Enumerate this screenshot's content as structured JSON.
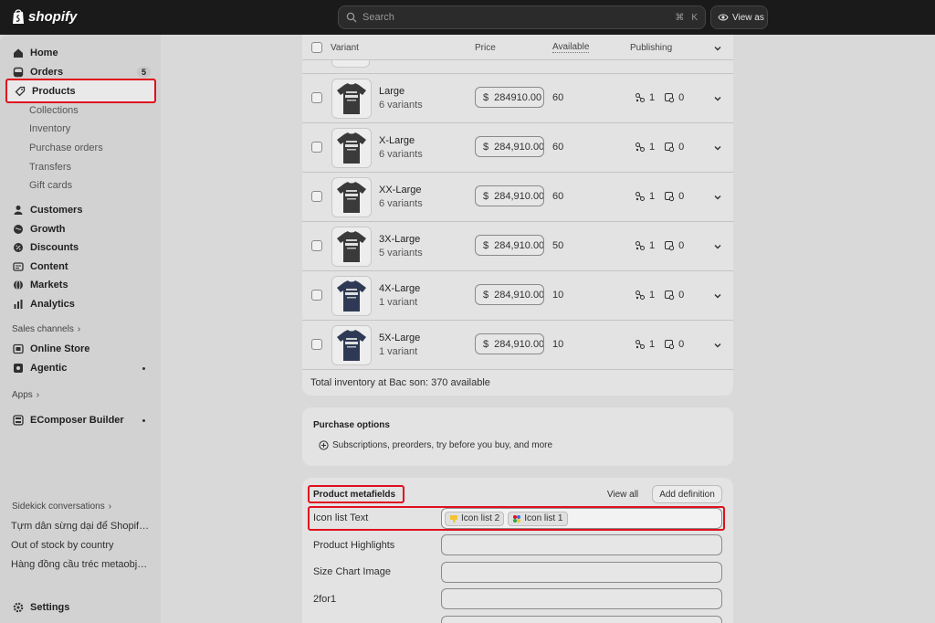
{
  "topbar": {
    "logo": "shopify",
    "search_placeholder": "Search",
    "shortcut_cmd": "⌘",
    "shortcut_key": "K",
    "view_as": "View as"
  },
  "sidebar": {
    "items": [
      {
        "label": "Home",
        "icon": "home-icon"
      },
      {
        "label": "Orders",
        "icon": "orders-icon",
        "badge": "5"
      },
      {
        "label": "Products",
        "icon": "tag-icon"
      },
      {
        "label": "Collections"
      },
      {
        "label": "Inventory"
      },
      {
        "label": "Purchase orders"
      },
      {
        "label": "Transfers"
      },
      {
        "label": "Gift cards"
      },
      {
        "label": "Customers",
        "icon": "person-icon"
      },
      {
        "label": "Growth",
        "icon": "globe-icon"
      },
      {
        "label": "Discounts",
        "icon": "discount-icon"
      },
      {
        "label": "Content",
        "icon": "content-icon"
      },
      {
        "label": "Markets",
        "icon": "globe-icon"
      },
      {
        "label": "Analytics",
        "icon": "chart-icon"
      }
    ],
    "sales_channels_label": "Sales channels",
    "channels": [
      {
        "label": "Online Store",
        "icon": "store-icon"
      },
      {
        "label": "Agentic",
        "icon": "agentic-icon"
      }
    ],
    "apps_label": "Apps",
    "apps": [
      {
        "label": "EComposer Builder",
        "icon": "app-icon"
      }
    ],
    "sidekick_label": "Sidekick conversations",
    "conversations": [
      "Tựm dẫn sừng dại để Shopify ...",
      "Out of stock by country",
      "Hàng đồng cầu tréc metaobjec..."
    ],
    "settings": "Settings"
  },
  "variants_table": {
    "headers": {
      "variant": "Variant",
      "price": "Price",
      "available": "Available",
      "publishing": "Publishing"
    },
    "currency": "$",
    "rows": [
      {
        "name": "Large",
        "count": "6 variants",
        "price": "284910.00",
        "available": "60",
        "pub1": "1",
        "pub2": "0",
        "color": "#3a3a3a"
      },
      {
        "name": "X-Large",
        "count": "6 variants",
        "price": "284,910.00",
        "available": "60",
        "pub1": "1",
        "pub2": "0",
        "color": "#3a3a3a"
      },
      {
        "name": "XX-Large",
        "count": "6 variants",
        "price": "284,910.00",
        "available": "60",
        "pub1": "1",
        "pub2": "0",
        "color": "#3a3a3a"
      },
      {
        "name": "3X-Large",
        "count": "5 variants",
        "price": "284,910.00",
        "available": "50",
        "pub1": "1",
        "pub2": "0",
        "color": "#3a3a3a"
      },
      {
        "name": "4X-Large",
        "count": "1 variant",
        "price": "284,910.00",
        "available": "10",
        "pub1": "1",
        "pub2": "0",
        "color": "#2e3a55"
      },
      {
        "name": "5X-Large",
        "count": "1 variant",
        "price": "284,910.00",
        "available": "10",
        "pub1": "1",
        "pub2": "0",
        "color": "#2e3a55"
      }
    ],
    "total_inventory": "Total inventory at Bac son: 370 available"
  },
  "purchase_options": {
    "title": "Purchase options",
    "link": "Subscriptions, preorders, try before you buy, and more"
  },
  "metafields": {
    "title": "Product metafields",
    "view_all": "View all",
    "add_definition": "Add definition",
    "fields": [
      {
        "label": "Icon list Text",
        "chips": [
          "Icon list 2",
          "Icon list 1"
        ]
      },
      {
        "label": "Product Highlights"
      },
      {
        "label": "Size Chart Image"
      },
      {
        "label": "2for1"
      }
    ]
  },
  "colors": {
    "highlight": "#e0101e",
    "topbar": "#1a1a1a"
  }
}
